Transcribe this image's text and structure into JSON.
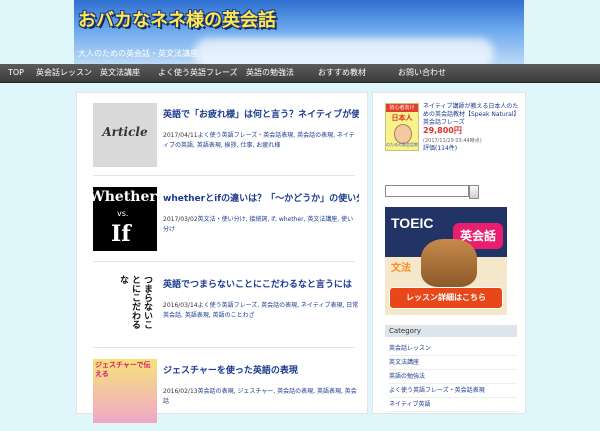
{
  "header": {
    "site_title": "おバカなネネ様の英会話",
    "tagline": "大人のための英会話・英文法講座"
  },
  "nav": [
    {
      "label": "TOP",
      "name": "nav-top"
    },
    {
      "label": "英会話レッスン",
      "name": "nav-lesson"
    },
    {
      "label": "英文法講座",
      "name": "nav-grammar"
    },
    {
      "label": "よく使う英語フレーズ",
      "name": "nav-phrases"
    },
    {
      "label": "英語の勉強法",
      "name": "nav-study"
    },
    {
      "label": "おすすめ教材",
      "name": "nav-materials"
    },
    {
      "label": "お問い合わせ",
      "name": "nav-contact"
    }
  ],
  "posts": [
    {
      "title": "英語で「お疲れ様」は何と言う？ネイティブが使う自然なフレーズまとめ",
      "date": "2017/04/11",
      "meta_category": "よく使う英語フレーズ・英会話表現",
      "meta_tags": ", 英会話の表現, ネイティブの英語, 英語表現, 挨拶, 仕事, お疲れ様",
      "thumb_text": "Article"
    },
    {
      "title": "whetherとifの違いは？「〜かどうか」の使い分けを徹底解説！",
      "date": "2017/03/02",
      "meta_category": "英文法・使い分け",
      "meta_tags": ", 接続詞, if, whether, 英文法講座, 使い分け",
      "thumb_top": "Whether",
      "thumb_vs": "vs.",
      "thumb_if": "If"
    },
    {
      "title": "英語でつまらないことにこだわるなと言うには",
      "date": "2016/03/14",
      "meta_category": "よく使う英語フレーズ",
      "meta_tags": ", 英会話の表現, ネイティブ表現, 日常英会話, 英語表現, 英語のことわざ",
      "thumb_text": "つまらないことにこだわるな"
    },
    {
      "title": "ジェスチャーを使った英語の表現",
      "date": "2016/02/13",
      "meta_category": "英会話の表現",
      "meta_tags": ", ジェスチャー, 英会話の表現, 英語表現, 英会話",
      "thumb_text": "ジェスチャーで伝える"
    }
  ],
  "sidebar": {
    "product": {
      "book_label": "初心者向け",
      "book_title": "日本人",
      "book_sub": "のための英会話教材",
      "title": "ネイティブ講師が教える日本人のための英会話教材【Speak Natural】英会話フレーズ",
      "price": "29,800円",
      "price_date": "(2017/11/29 03:44時点)",
      "review": "評価(114件)"
    },
    "search_placeholder": "",
    "banner": {
      "toeic": "TOEIC",
      "eikaiwa": "英会話",
      "bunpo": "文法",
      "lesson": "レッスン詳細はこちら"
    },
    "category_header": "Category",
    "categories": [
      "英会話レッスン",
      "英文法講座",
      "英語の勉強法",
      "よく使う英語フレーズ・英会話表現",
      "ネイティブ英語"
    ]
  }
}
